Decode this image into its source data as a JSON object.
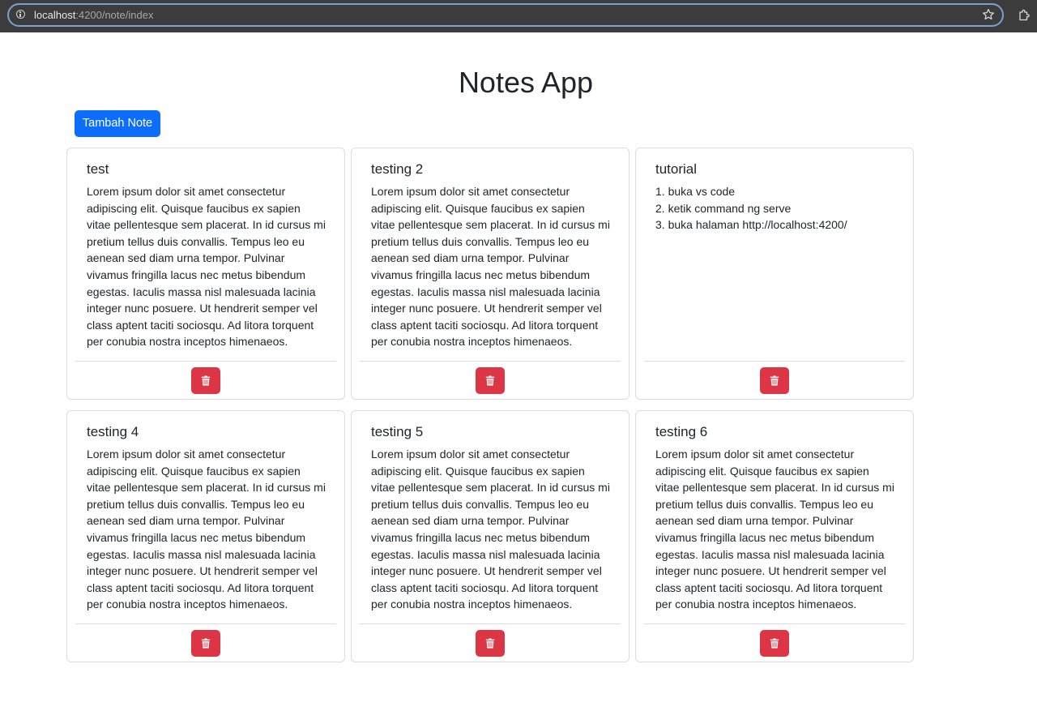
{
  "browser": {
    "url_host": "localhost",
    "url_path": ":4200/note/index"
  },
  "page": {
    "title": "Notes App",
    "add_button_label": "Tambah Note"
  },
  "notes": [
    {
      "title": "test",
      "body": "Lorem ipsum dolor sit amet consectetur adipiscing elit. Quisque faucibus ex sapien vitae pellentesque sem placerat. In id cursus mi pretium tellus duis convallis. Tempus leo eu aenean sed diam urna tempor. Pulvinar vivamus fringilla lacus nec metus bibendum egestas. Iaculis massa nisl malesuada lacinia integer nunc posuere. Ut hendrerit semper vel class aptent taciti sociosqu. Ad litora torquent per conubia nostra inceptos himenaeos."
    },
    {
      "title": "testing 2",
      "body": "Lorem ipsum dolor sit amet consectetur adipiscing elit. Quisque faucibus ex sapien vitae pellentesque sem placerat. In id cursus mi pretium tellus duis convallis. Tempus leo eu aenean sed diam urna tempor. Pulvinar vivamus fringilla lacus nec metus bibendum egestas. Iaculis massa nisl malesuada lacinia integer nunc posuere. Ut hendrerit semper vel class aptent taciti sociosqu. Ad litora torquent per conubia nostra inceptos himenaeos."
    },
    {
      "title": "tutorial",
      "body": "1. buka vs code\n2. ketik command ng serve\n3. buka halaman http://localhost:4200/"
    },
    {
      "title": "testing 4",
      "body": "Lorem ipsum dolor sit amet consectetur adipiscing elit. Quisque faucibus ex sapien vitae pellentesque sem placerat. In id cursus mi pretium tellus duis convallis. Tempus leo eu aenean sed diam urna tempor. Pulvinar vivamus fringilla lacus nec metus bibendum egestas. Iaculis massa nisl malesuada lacinia integer nunc posuere. Ut hendrerit semper vel class aptent taciti sociosqu. Ad litora torquent per conubia nostra inceptos himenaeos."
    },
    {
      "title": "testing 5",
      "body": "Lorem ipsum dolor sit amet consectetur adipiscing elit. Quisque faucibus ex sapien vitae pellentesque sem placerat. In id cursus mi pretium tellus duis convallis. Tempus leo eu aenean sed diam urna tempor. Pulvinar vivamus fringilla lacus nec metus bibendum egestas. Iaculis massa nisl malesuada lacinia integer nunc posuere. Ut hendrerit semper vel class aptent taciti sociosqu. Ad litora torquent per conubia nostra inceptos himenaeos."
    },
    {
      "title": "testing 6",
      "body": "Lorem ipsum dolor sit amet consectetur adipiscing elit. Quisque faucibus ex sapien vitae pellentesque sem placerat. In id cursus mi pretium tellus duis convallis. Tempus leo eu aenean sed diam urna tempor. Pulvinar vivamus fringilla lacus nec metus bibendum egestas. Iaculis massa nisl malesuada lacinia integer nunc posuere. Ut hendrerit semper vel class aptent taciti sociosqu. Ad litora torquent per conubia nostra inceptos himenaeos."
    }
  ],
  "icons": {
    "info": "info-icon",
    "bookmark": "star-icon",
    "extensions": "extension-icon",
    "delete": "trash-icon"
  },
  "colors": {
    "primary": "#0d6efd",
    "danger": "#dc3545",
    "chrome_bar": "#3c3c3c"
  }
}
